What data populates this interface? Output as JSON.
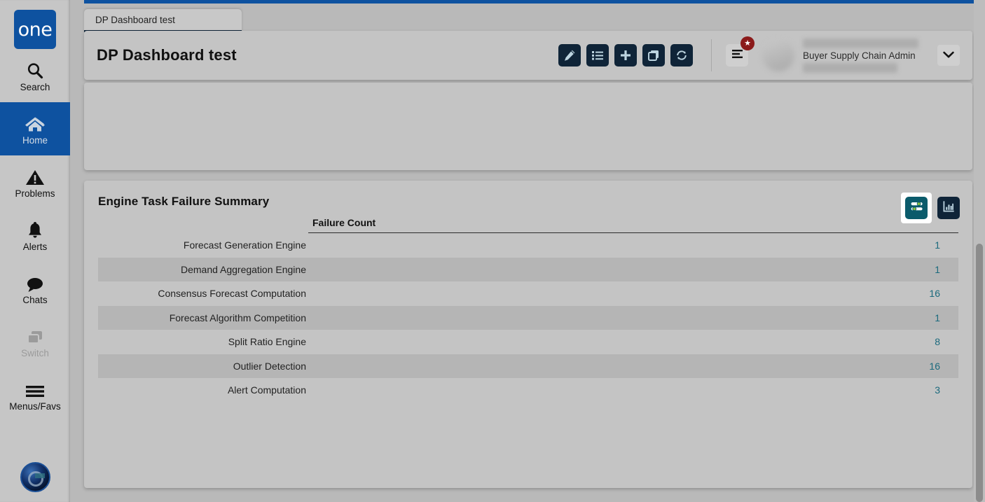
{
  "sidebar": {
    "logo_text": "one",
    "items": [
      {
        "label": "Search",
        "icon": "search-icon",
        "state": "normal"
      },
      {
        "label": "Home",
        "icon": "home-icon",
        "state": "active"
      },
      {
        "label": "Problems",
        "icon": "warning-triangle-icon",
        "state": "normal"
      },
      {
        "label": "Alerts",
        "icon": "bell-icon",
        "state": "normal"
      },
      {
        "label": "Chats",
        "icon": "chat-bubble-icon",
        "state": "normal"
      },
      {
        "label": "Switch",
        "icon": "switch-windows-icon",
        "state": "disabled"
      },
      {
        "label": "Menus/Favs",
        "icon": "hamburger-icon",
        "state": "normal"
      }
    ],
    "bottom_logo": "globe-orb-icon"
  },
  "tab": {
    "label": "DP Dashboard test"
  },
  "header": {
    "title": "DP Dashboard test",
    "tools": [
      {
        "name": "edit-button",
        "icon": "pencil-icon"
      },
      {
        "name": "list-button",
        "icon": "list-icon"
      },
      {
        "name": "add-button",
        "icon": "plus-icon"
      },
      {
        "name": "copy-button",
        "icon": "copy-icon"
      },
      {
        "name": "refresh-button",
        "icon": "refresh-icon"
      }
    ],
    "notifications_badge": "★",
    "user_role": "Buyer Supply Chain Admin"
  },
  "panel": {
    "title": "Engine Task Failure Summary",
    "actions": [
      {
        "name": "settings-button",
        "icon": "sliders-icon",
        "selected": true
      },
      {
        "name": "chart-view-button",
        "icon": "bar-chart-icon",
        "selected": false
      }
    ]
  },
  "chart_data": {
    "type": "table",
    "title": "Engine Task Failure Summary",
    "columns": [
      "",
      "Failure Count"
    ],
    "categories": [
      "Forecast Generation Engine",
      "Demand Aggregation Engine",
      "Consensus Forecast Computation",
      "Forecast Algorithm Competition",
      "Split Ratio Engine",
      "Outlier Detection",
      "Alert Computation"
    ],
    "values": [
      1,
      1,
      16,
      1,
      8,
      16,
      3
    ],
    "xlabel": "",
    "ylabel": "Failure Count",
    "rows": [
      {
        "label": "Forecast Generation Engine",
        "value": "1"
      },
      {
        "label": "Demand Aggregation Engine",
        "value": "1"
      },
      {
        "label": "Consensus Forecast Computation",
        "value": "16"
      },
      {
        "label": "Forecast Algorithm Competition",
        "value": "1"
      },
      {
        "label": "Split Ratio Engine",
        "value": "8"
      },
      {
        "label": "Outlier Detection",
        "value": "16"
      },
      {
        "label": "Alert Computation",
        "value": "3"
      }
    ]
  },
  "colors": {
    "brand_blue": "#0e52a0",
    "icon_dark": "#0f2438",
    "icon_glyph": "#bcd4e0",
    "teal": "#0b5b6b",
    "value_teal": "#1b6a7d",
    "badge_red": "#8b1a1a",
    "page_bg": "#b9b9b9",
    "card_bg": "#c4c4c4",
    "row_alt": "#b5b5b5"
  }
}
